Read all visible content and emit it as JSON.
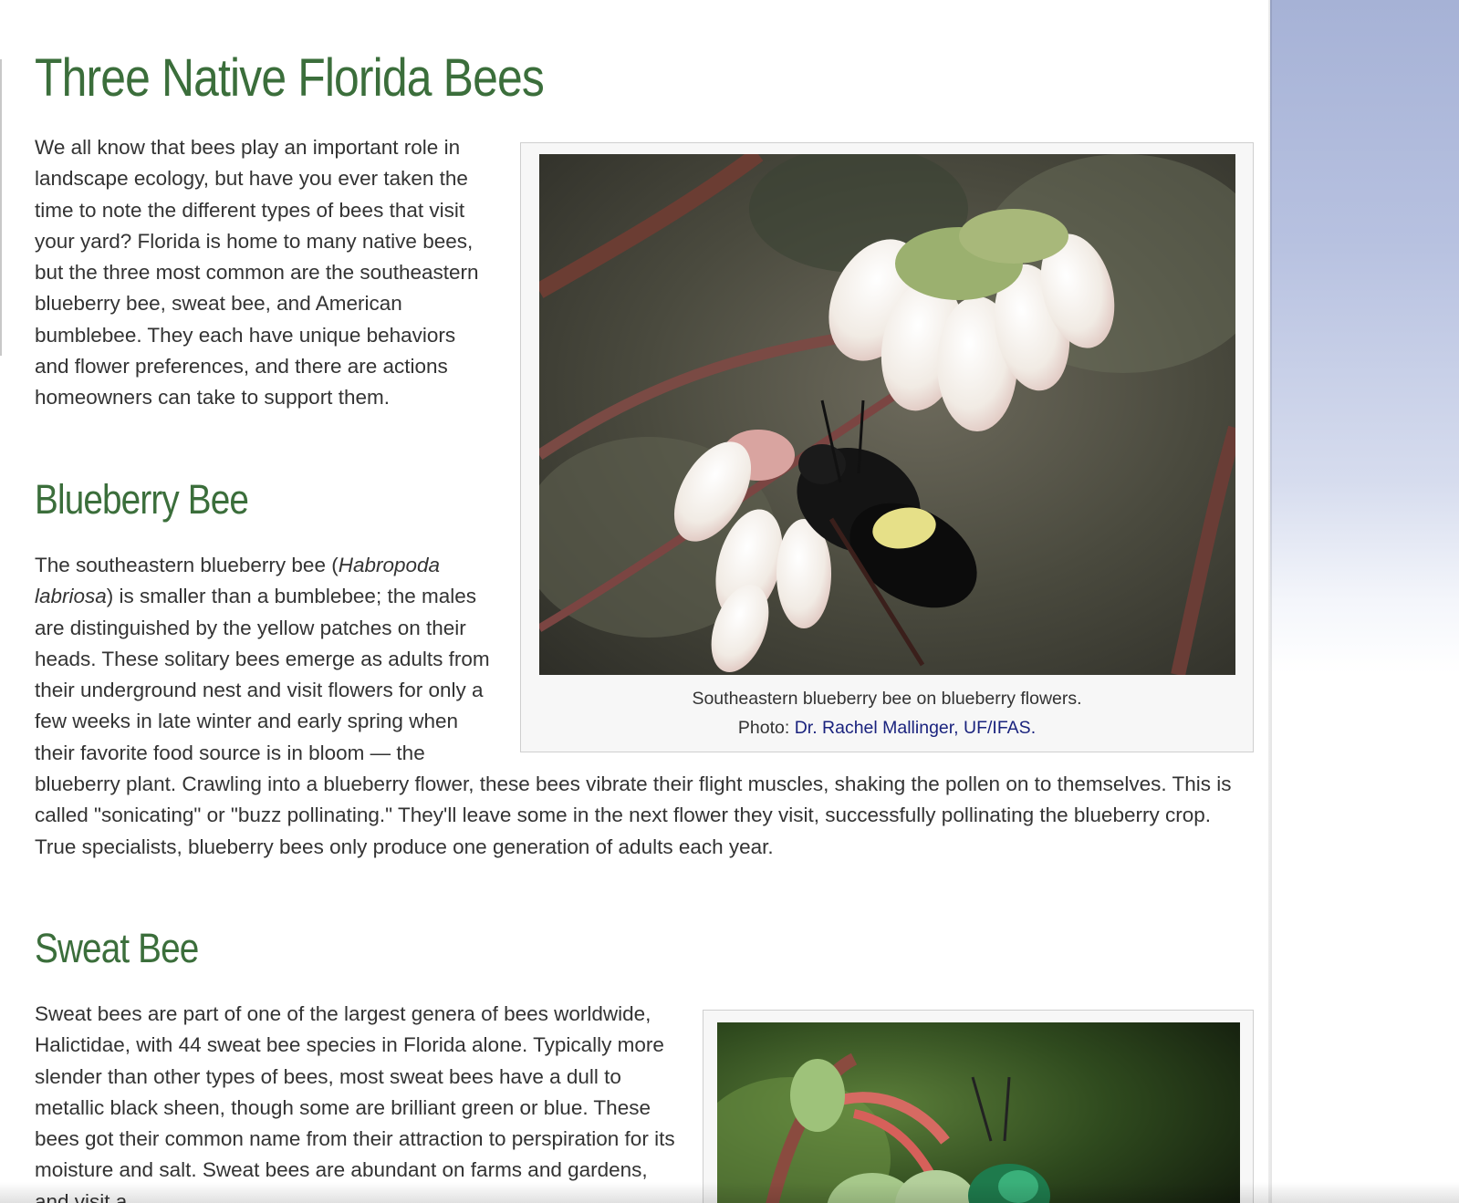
{
  "page": {
    "title": "Three Native Florida Bees"
  },
  "intro": {
    "text": "We all know that bees play an important role in landscape ecology, but have you ever taken the time to note the different types of bees that visit your yard? Florida is home to many native bees, but the three most common are the southeastern blueberry bee, sweat bee, and American bumblebee. They each have unique behaviors and flower preferences, and there are actions homeowners can take to support them."
  },
  "blueberry": {
    "heading": "Blueberry Bee",
    "text_before": "The southeastern blueberry bee (",
    "species": "Habropoda labriosa",
    "text_after": ") is smaller than a bumblebee; the males are distinguished by the yellow patches on their heads. These solitary bees emerge as adults from their underground nest and visit flowers for only a few weeks in late winter and early spring when their favorite food source is in bloom — the blueberry plant. Crawling into a blueberry flower, these bees vibrate their flight muscles, shaking the pollen on to themselves. This is called \"sonicating\" or \"buzz pollinating.\" They'll leave some in the next flower they visit, successfully pollinating the blueberry crop. True specialists, blueberry bees only produce one generation of adults each year.",
    "figure": {
      "caption_line1": "Southeastern blueberry bee on blueberry flowers.",
      "caption_prefix": "Photo: ",
      "caption_link": "Dr. Rachel Mallinger, UF/IFAS."
    }
  },
  "sweat": {
    "heading": "Sweat Bee",
    "text": "Sweat bees are part of one of the largest genera of bees worldwide, Halictidae, with 44 sweat bee species in Florida alone. Typically more slender than other types of bees, most sweat bees have a dull to metallic black sheen, though some are brilliant green or blue. These bees got their common name from their attraction to perspiration for its moisture and salt. Sweat bees are abundant on farms and gardens, and visit a"
  },
  "colors": {
    "heading_green": "#3b6e3b",
    "body_text": "#333333",
    "link_blue": "#1a237e",
    "sidebar_blue": "#a6b2d6"
  }
}
